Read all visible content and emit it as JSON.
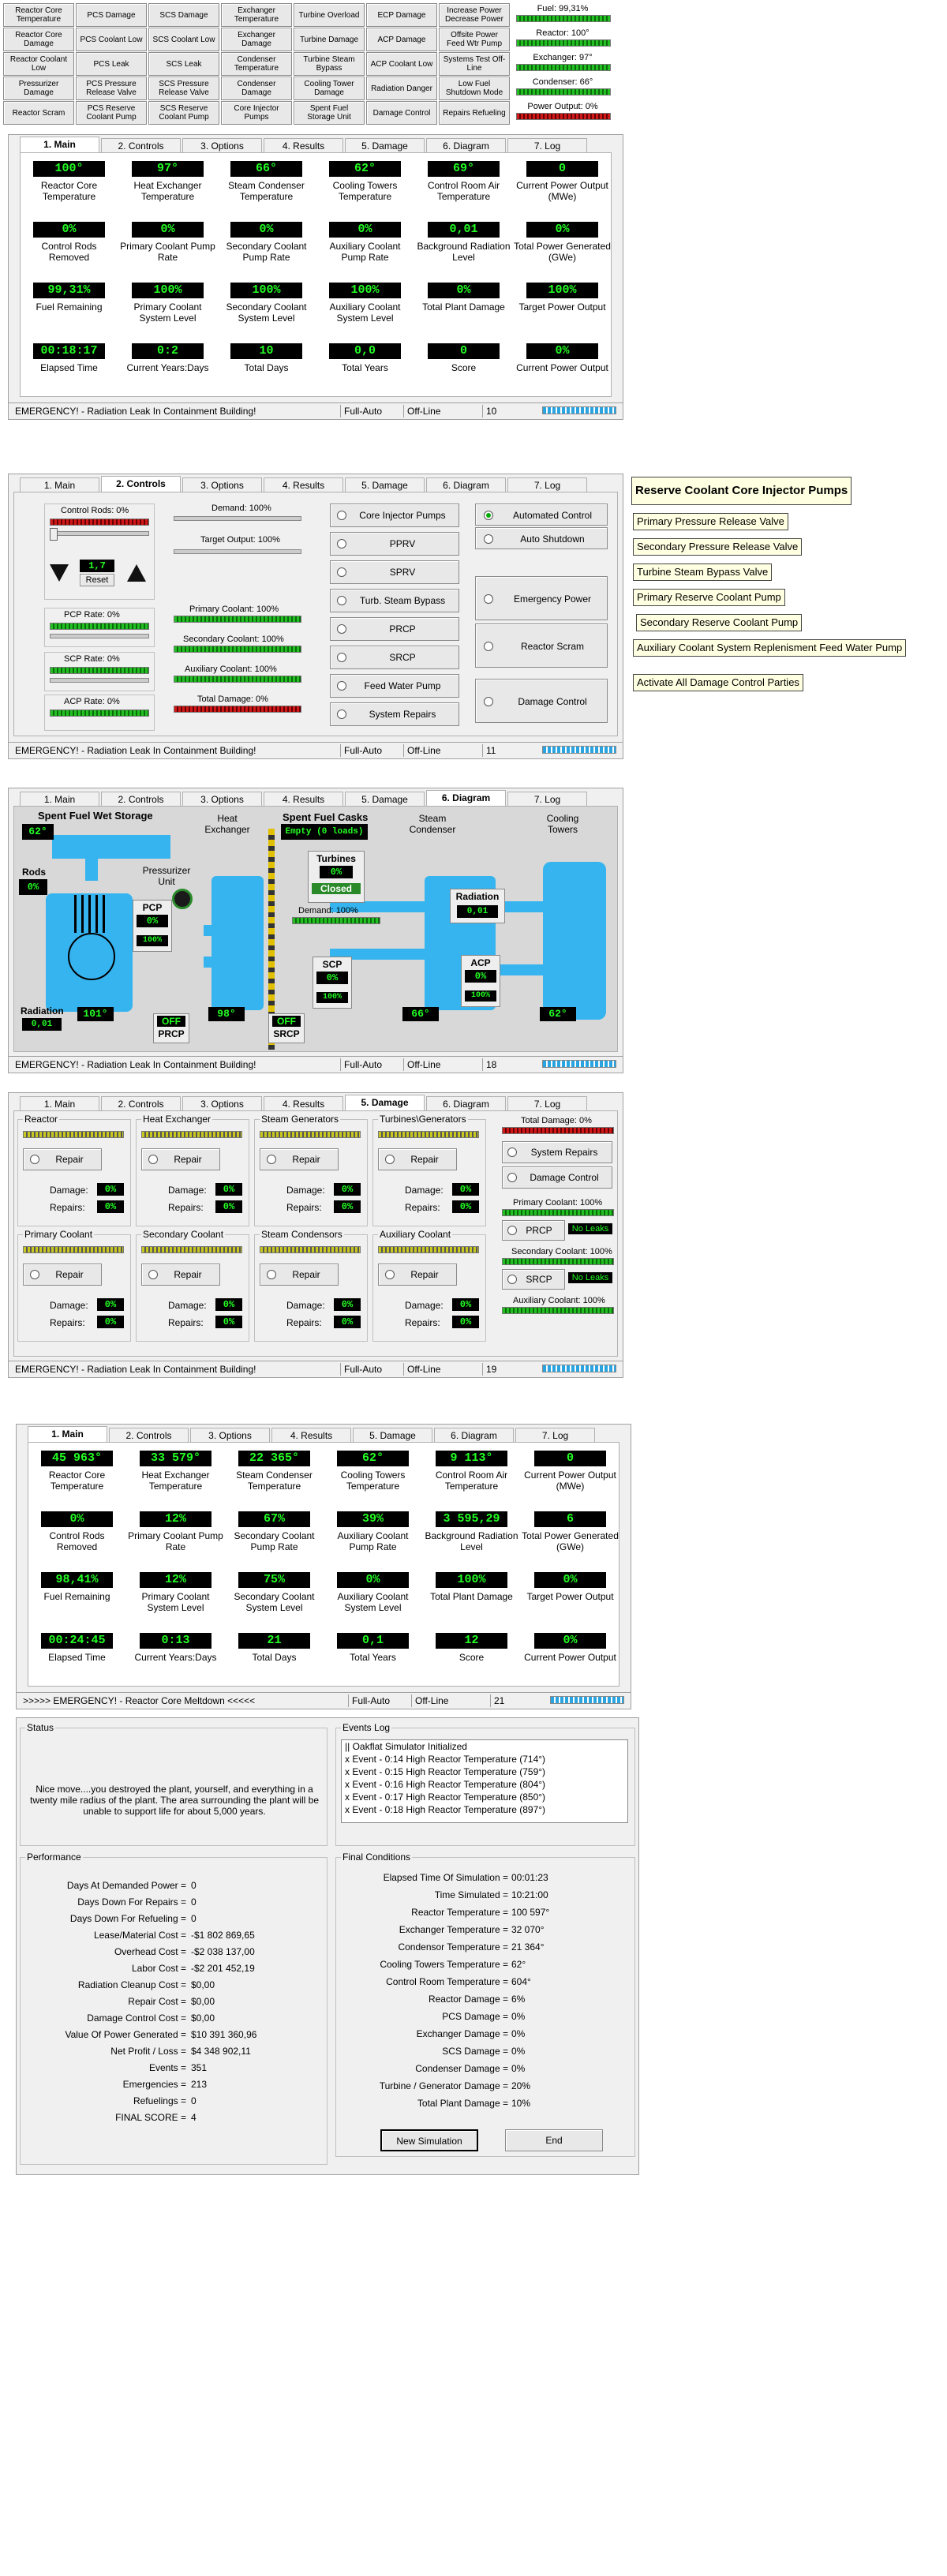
{
  "top": {
    "grid": [
      [
        "Reactor Core Temperature",
        "PCS Damage",
        "SCS Damage",
        "Exchanger Temperature",
        "Turbine Overload",
        "ECP Damage",
        "Increase Power Decrease Power"
      ],
      [
        "Reactor Core Damage",
        "PCS Coolant Low",
        "SCS Coolant Low",
        "Exchanger Damage",
        "Turbine Damage",
        "ACP Damage",
        "Offsite Power Feed Wtr Pump"
      ],
      [
        "Reactor Coolant Low",
        "PCS Leak",
        "SCS Leak",
        "Condenser Temperature",
        "Turbine Steam Bypass",
        "ACP Coolant Low",
        "Systems Test Off-Line"
      ],
      [
        "Pressurizer Damage",
        "PCS Pressure Release Valve",
        "SCS Pressure Release Valve",
        "Condenser Damage",
        "Cooling Tower Damage",
        "Radiation Danger",
        "Low Fuel Shutdown Mode"
      ],
      [
        "Reactor Scram",
        "PCS Reserve Coolant Pump",
        "SCS Reserve Coolant Pump",
        "Core Injector Pumps",
        "Spent Fuel Storage Unit",
        "Damage Control",
        "Repairs Refueling"
      ]
    ],
    "meters": [
      "Fuel: 99,31%",
      "Reactor: 100°",
      "Exchanger: 97°",
      "Condenser: 66°",
      "Power Output: 0%"
    ]
  },
  "tabs": [
    "1. Main",
    "2. Controls",
    "3. Options",
    "4. Results",
    "5. Damage",
    "6. Diagram",
    "7. Log"
  ],
  "main1": {
    "cells": [
      [
        "100°",
        "Reactor Core Temperature"
      ],
      [
        "97°",
        "Heat Exchanger Temperature"
      ],
      [
        "66°",
        "Steam Condenser Temperature"
      ],
      [
        "62°",
        "Cooling Towers Temperature"
      ],
      [
        "69°",
        "Control Room Air Temperature"
      ],
      [
        "0",
        "Current Power Output (MWe)"
      ],
      [
        "0%",
        "Control Rods Removed"
      ],
      [
        "0%",
        "Primary Coolant Pump Rate"
      ],
      [
        "0%",
        "Secondary Coolant Pump Rate"
      ],
      [
        "0%",
        "Auxiliary Coolant Pump Rate"
      ],
      [
        "0,01",
        "Background Radiation Level"
      ],
      [
        "0%",
        "Total Power Generated (GWe)"
      ],
      [
        "99,31%",
        "Fuel Remaining"
      ],
      [
        "100%",
        "Primary Coolant System Level"
      ],
      [
        "100%",
        "Secondary Coolant System Level"
      ],
      [
        "100%",
        "Auxiliary Coolant System Level"
      ],
      [
        "0%",
        "Total Plant Damage"
      ],
      [
        "100%",
        "Target Power Output"
      ],
      [
        "00:18:17",
        "Elapsed Time"
      ],
      [
        "0:2",
        "Current Years:Days"
      ],
      [
        "10",
        "Total Days"
      ],
      [
        "0,0",
        "Total Years"
      ],
      [
        "0",
        "Score"
      ],
      [
        "0%",
        "Current Power Output"
      ]
    ],
    "status": [
      "EMERGENCY! - Radiation Leak In Containment Building!",
      "Full-Auto",
      "Off-Line",
      "10"
    ]
  },
  "controls": {
    "rods": "Control Rods: 0%",
    "rodval": "1,7",
    "reset": "Reset",
    "pcp": "PCP Rate: 0%",
    "scp": "SCP Rate: 0%",
    "acp": "ACP Rate: 0%",
    "demand": "Demand: 100%",
    "target": "Target Output: 100%",
    "pc": "Primary Coolant: 100%",
    "sc": "Secondary Coolant: 100%",
    "ac": "Auxiliary Coolant: 100%",
    "td": "Total Damage: 0%",
    "mid": [
      "Core Injector Pumps",
      "PPRV",
      "SPRV",
      "Turb. Steam Bypass",
      "PRCP",
      "SRCP",
      "Feed Water Pump",
      "System Repairs"
    ],
    "right": [
      "Automated Control",
      "Auto Shutdown",
      "Emergency Power",
      "Reactor Scram",
      "Damage Control"
    ],
    "tips": [
      "Reserve Coolant Core Injector Pumps",
      "Primary Pressure Release Valve",
      "Secondary Pressure Release Valve",
      "Turbine Steam Bypass Valve",
      "Primary Reserve Coolant Pump",
      "Secondary Reserve Coolant Pump",
      "Auxiliary Coolant System Replenisment Feed Water Pump",
      "Activate All Damage Control Parties"
    ],
    "status": [
      "EMERGENCY! - Radiation Leak In Containment Building!",
      "Full-Auto",
      "Off-Line",
      "11"
    ]
  },
  "diagram": {
    "spent": "Spent Fuel Wet Storage",
    "spentval": "62°",
    "hx": "Heat Exchanger",
    "casks": "Spent Fuel Casks",
    "casksval": "Empty  (0 loads)",
    "steam": "Steam Condenser",
    "cooling": "Cooling Towers",
    "rods": "Rods",
    "rodsval": "0%",
    "press": "Pressurizer Unit",
    "pcp": "PCP",
    "pcpval": "0%",
    "pcppct": "100%",
    "turb": "Turbines",
    "turbval": "0%",
    "closed": "Closed",
    "demand": "Demand: 100%",
    "rad": "Radiation",
    "radval": "0,01",
    "acp": "ACP",
    "acpval": "0%",
    "acppct": "100%",
    "scp": "SCP",
    "scpval": "0%",
    "scppct": "100%",
    "radl": "Radiation",
    "radlval": "0,01",
    "t1": "101°",
    "off1": "OFF",
    "prcp": "PRCP",
    "t2": "98°",
    "off2": "OFF",
    "srcp": "SRCP",
    "t3": "66°",
    "t4": "62°",
    "status": [
      "EMERGENCY! - Radiation Leak In Containment Building!",
      "Full-Auto",
      "Off-Line",
      "18"
    ]
  },
  "damage": {
    "groups": [
      "Reactor",
      "Heat Exchanger",
      "Steam Generators",
      "Turbines\\Generators",
      "Primary Coolant",
      "Secondary Coolant",
      "Steam Condensors",
      "Auxiliary Coolant"
    ],
    "repair": "Repair",
    "dmg": "Damage:",
    "rep": "Repairs:",
    "zero": "0%",
    "td": "Total Damage: 0%",
    "sysrep": "System Repairs",
    "dmgctl": "Damage Control",
    "pc": "Primary Coolant: 100%",
    "prcp": "PRCP",
    "noleak": "No Leaks",
    "sc": "Secondary Coolant: 100%",
    "srcp": "SRCP",
    "ac": "Auxiliary Coolant: 100%",
    "status": [
      "EMERGENCY! - Radiation Leak In Containment Building!",
      "Full-Auto",
      "Off-Line",
      "19"
    ]
  },
  "main2": {
    "cells": [
      [
        "45 963°",
        "Reactor Core Temperature"
      ],
      [
        "33 579°",
        "Heat Exchanger Temperature"
      ],
      [
        "22 365°",
        "Steam Condenser Temperature"
      ],
      [
        "62°",
        "Cooling Towers Temperature"
      ],
      [
        "9 113°",
        "Control Room Air Temperature"
      ],
      [
        "0",
        "Current Power Output (MWe)"
      ],
      [
        "0%",
        "Control Rods Removed"
      ],
      [
        "12%",
        "Primary Coolant Pump Rate"
      ],
      [
        "67%",
        "Secondary Coolant Pump Rate"
      ],
      [
        "39%",
        "Auxiliary Coolant Pump Rate"
      ],
      [
        "3 595,29",
        "Background Radiation Level"
      ],
      [
        "6",
        "Total Power Generated (GWe)"
      ],
      [
        "98,41%",
        "Fuel Remaining"
      ],
      [
        "12%",
        "Primary Coolant System Level"
      ],
      [
        "75%",
        "Secondary Coolant System Level"
      ],
      [
        "0%",
        "Auxiliary Coolant System Level"
      ],
      [
        "100%",
        "Total Plant Damage"
      ],
      [
        "0%",
        "Target Power Output"
      ],
      [
        "00:24:45",
        "Elapsed Time"
      ],
      [
        "0:13",
        "Current Years:Days"
      ],
      [
        "21",
        "Total Days"
      ],
      [
        "0,1",
        "Total Years"
      ],
      [
        "12",
        "Score"
      ],
      [
        "0%",
        "Current Power Output"
      ]
    ],
    "status": [
      ">>>>> EMERGENCY! - Reactor Core Meltdown <<<<<",
      "Full-Auto",
      "Off-Line",
      "21"
    ]
  },
  "results": {
    "status_t": "Status",
    "status_msg": "Nice move....you destroyed the plant, yourself, and everything in a twenty mile radius of the plant.  The area surrounding the plant will be unable to support life for about 5,000 years.",
    "events_t": "Events Log",
    "events": [
      "|| Oakflat Simulator Initialized",
      "x Event - 0:14 High Reactor Temperature (714°)",
      "x Event - 0:15 High Reactor Temperature (759°)",
      "x Event - 0:16 High Reactor Temperature (804°)",
      "x Event - 0:17 High Reactor Temperature (850°)",
      "x Event - 0:18 High Reactor Temperature (897°)"
    ],
    "perf_t": "Performance",
    "perf": [
      [
        "Days At Demanded Power =",
        "0"
      ],
      [
        "Days Down For Repairs =",
        "0"
      ],
      [
        "Days Down For Refueling =",
        "0"
      ],
      [
        "Lease/Material Cost =",
        "-$1 802 869,65"
      ],
      [
        "Overhead Cost =",
        "-$2 038 137,00"
      ],
      [
        "Labor Cost =",
        "-$2 201 452,19"
      ],
      [
        "Radiation Cleanup Cost =",
        "$0,00"
      ],
      [
        "Repair Cost =",
        "$0,00"
      ],
      [
        "Damage Control Cost =",
        "$0,00"
      ],
      [
        "Value Of Power Generated =",
        "$10 391 360,96"
      ],
      [
        "Net Profit / Loss =",
        "$4 348 902,11"
      ],
      [
        "Events =",
        "351"
      ],
      [
        "Emergencies =",
        "213"
      ],
      [
        "Refuelings =",
        "0"
      ],
      [
        "FINAL SCORE =",
        "4"
      ]
    ],
    "final_t": "Final Conditions",
    "final": [
      [
        "Elapsed Time Of Simulation =",
        "00:01:23"
      ],
      [
        "Time Simulated =",
        "10:21:00"
      ],
      [
        "Reactor Temperature =",
        "100 597°"
      ],
      [
        "Exchanger Temperature =",
        "32 070°"
      ],
      [
        "Condensor Temperature =",
        "21 364°"
      ],
      [
        "Cooling Towers Temperature =",
        "62°"
      ],
      [
        "Control Room Temperature =",
        "604°"
      ],
      [
        "Reactor Damage =",
        "6%"
      ],
      [
        "PCS Damage =",
        "0%"
      ],
      [
        "Exchanger Damage =",
        "0%"
      ],
      [
        "SCS Damage =",
        "0%"
      ],
      [
        "Condenser Damage =",
        "0%"
      ],
      [
        "Turbine / Generator Damage =",
        "20%"
      ],
      [
        "Total Plant Damage =",
        "10%"
      ]
    ],
    "newsim": "New Simulation",
    "end": "End"
  }
}
